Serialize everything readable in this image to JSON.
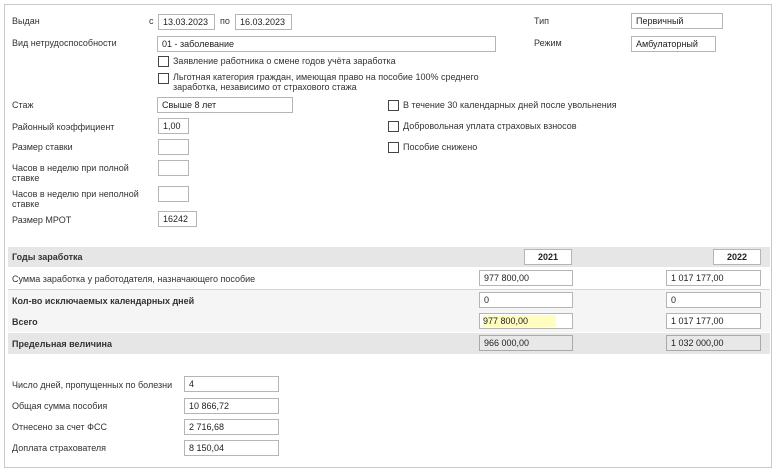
{
  "issued": {
    "label": "Выдан",
    "from_prefix": "с",
    "from_value": "13.03.2023",
    "to_prefix": "по",
    "to_value": "16.03.2023"
  },
  "type": {
    "label": "Тип",
    "value": "Первичный"
  },
  "mode": {
    "label": "Режим",
    "value": "Амбулаторный"
  },
  "disability": {
    "label": "Вид нетрудоспособности",
    "value": "01 - заболевание"
  },
  "checkboxes_left": [
    {
      "label": "Заявление работника о смене годов учёта заработка"
    },
    {
      "label": "Льготная категория граждан, имеющая право на пособие 100% среднего заработка, независимо от страхового стажа"
    }
  ],
  "fields": {
    "stazh": {
      "label": "Стаж",
      "value": "Свыше 8 лет"
    },
    "district_coef": {
      "label": "Районный коэффициент",
      "value": "1,00"
    },
    "rate_size": {
      "label": "Размер ставки",
      "value": ""
    },
    "hours_full": {
      "label": "Часов в неделю при полной ставке",
      "value": ""
    },
    "hours_part": {
      "label": "Часов в неделю при неполной ставке",
      "value": ""
    },
    "mrot": {
      "label": "Размер МРОТ",
      "value": "16242"
    }
  },
  "checkboxes_right": [
    {
      "label": "В течение 30 календарных дней после увольнения"
    },
    {
      "label": "Добровольная уплата страховых взносов"
    },
    {
      "label": "Пособие снижено"
    }
  ],
  "earnings": {
    "header": "Годы заработка",
    "year1": "2021",
    "year2": "2022",
    "rows": [
      {
        "label": "Сумма заработка у работодателя, назначающего пособие",
        "v1": "977 800,00",
        "v2": "1 017 177,00"
      },
      {
        "label": "Кол-во исключаемых календарных дней",
        "v1": "0",
        "v2": "0"
      },
      {
        "label": "Всего",
        "v1": "977 800,00",
        "v2": "1 017 177,00"
      },
      {
        "label": "Предельная величина",
        "v1": "966 000,00",
        "v2": "1 032 000,00"
      }
    ]
  },
  "totals": [
    {
      "label": "Число дней, пропущенных по болезни",
      "value": "4"
    },
    {
      "label": "Общая сумма пособия",
      "value": "10 866,72"
    },
    {
      "label": "Отнесено за счет ФСС",
      "value": "2 716,68"
    },
    {
      "label": "Доплата страхователя",
      "value": "8 150,04"
    }
  ]
}
